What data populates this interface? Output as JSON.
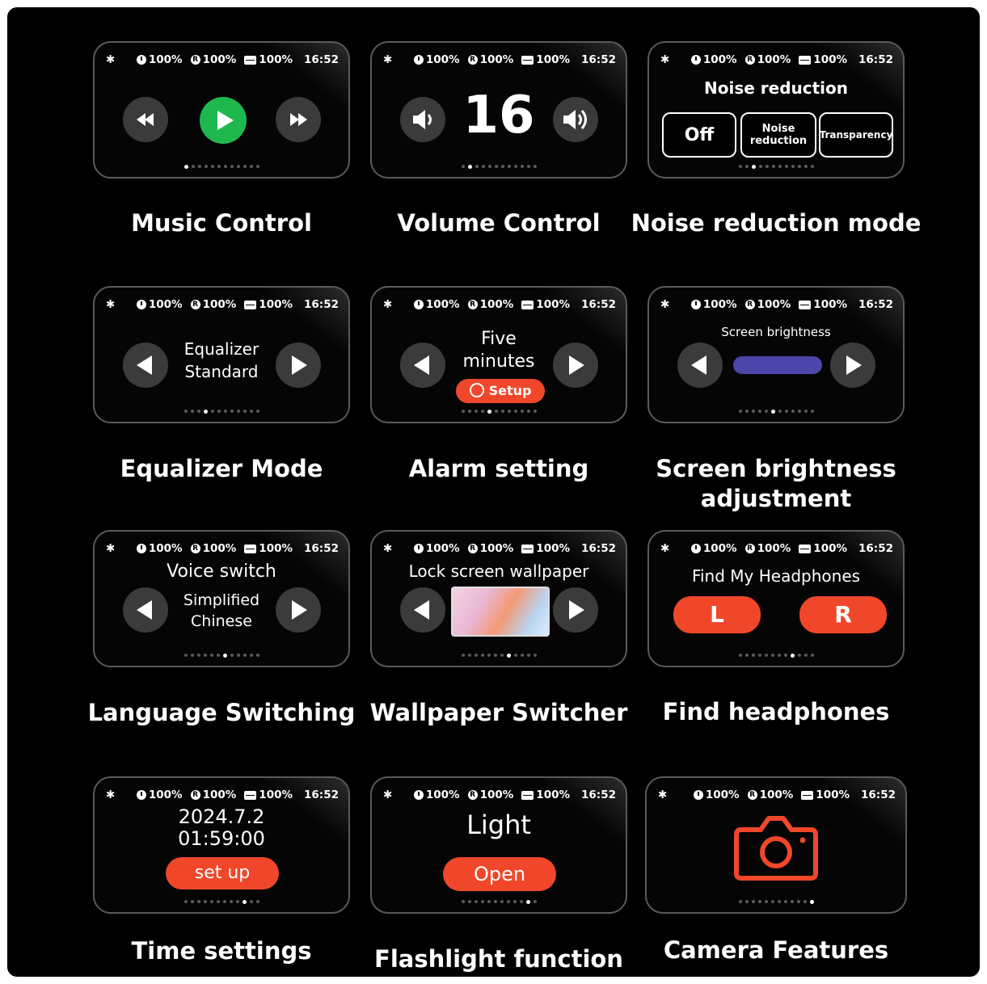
{
  "status": {
    "icon_bluetooth": "bluetooth-icon",
    "clock_level": "100%",
    "headphone_r_level": "100%",
    "battery_level": "100%",
    "time": "16:52"
  },
  "colors": {
    "accent_red": "#f0472a",
    "play_green": "#1fb84f",
    "brightness_bar": "#4b46a9"
  },
  "cards": {
    "music": {
      "caption": "Music Control",
      "page": 0
    },
    "volume": {
      "caption": "Volume Control",
      "value": "16",
      "page": 1
    },
    "noise": {
      "caption": "Noise reduction mode",
      "title": "Noise reduction",
      "options": [
        "Off",
        "Noise reduction",
        "Transparency"
      ],
      "page": 2
    },
    "equalizer": {
      "caption": "Equalizer Mode",
      "line1": "Equalizer",
      "line2": "Standard",
      "page": 3
    },
    "alarm": {
      "caption": "Alarm setting",
      "line1": "Five",
      "line2": "minutes",
      "button": "Setup",
      "page": 4
    },
    "brightness": {
      "caption_line1": "Screen brightness",
      "caption_line2": "adjustment",
      "title": "Screen brightness",
      "level": 1.0,
      "page": 5
    },
    "language": {
      "caption": "Language Switching",
      "title": "Voice switch",
      "line1": "Simplified",
      "line2": "Chinese",
      "page": 6
    },
    "wallpaper": {
      "caption": "Wallpaper Switcher",
      "title": "Lock screen wallpaper",
      "page": 7
    },
    "find": {
      "caption": "Find headphones",
      "title": "Find My Headphones",
      "left": "L",
      "right": "R",
      "page": 8
    },
    "timeset": {
      "caption": "Time settings",
      "date": "2024.7.2",
      "clock": "01:59:00",
      "button": "set up",
      "page": 9
    },
    "flashlight": {
      "caption": "Flashlight function",
      "title": "Light",
      "button": "Open",
      "page": 10
    },
    "camera": {
      "caption": "Camera Features",
      "icon": "camera-icon",
      "page": 11
    }
  }
}
